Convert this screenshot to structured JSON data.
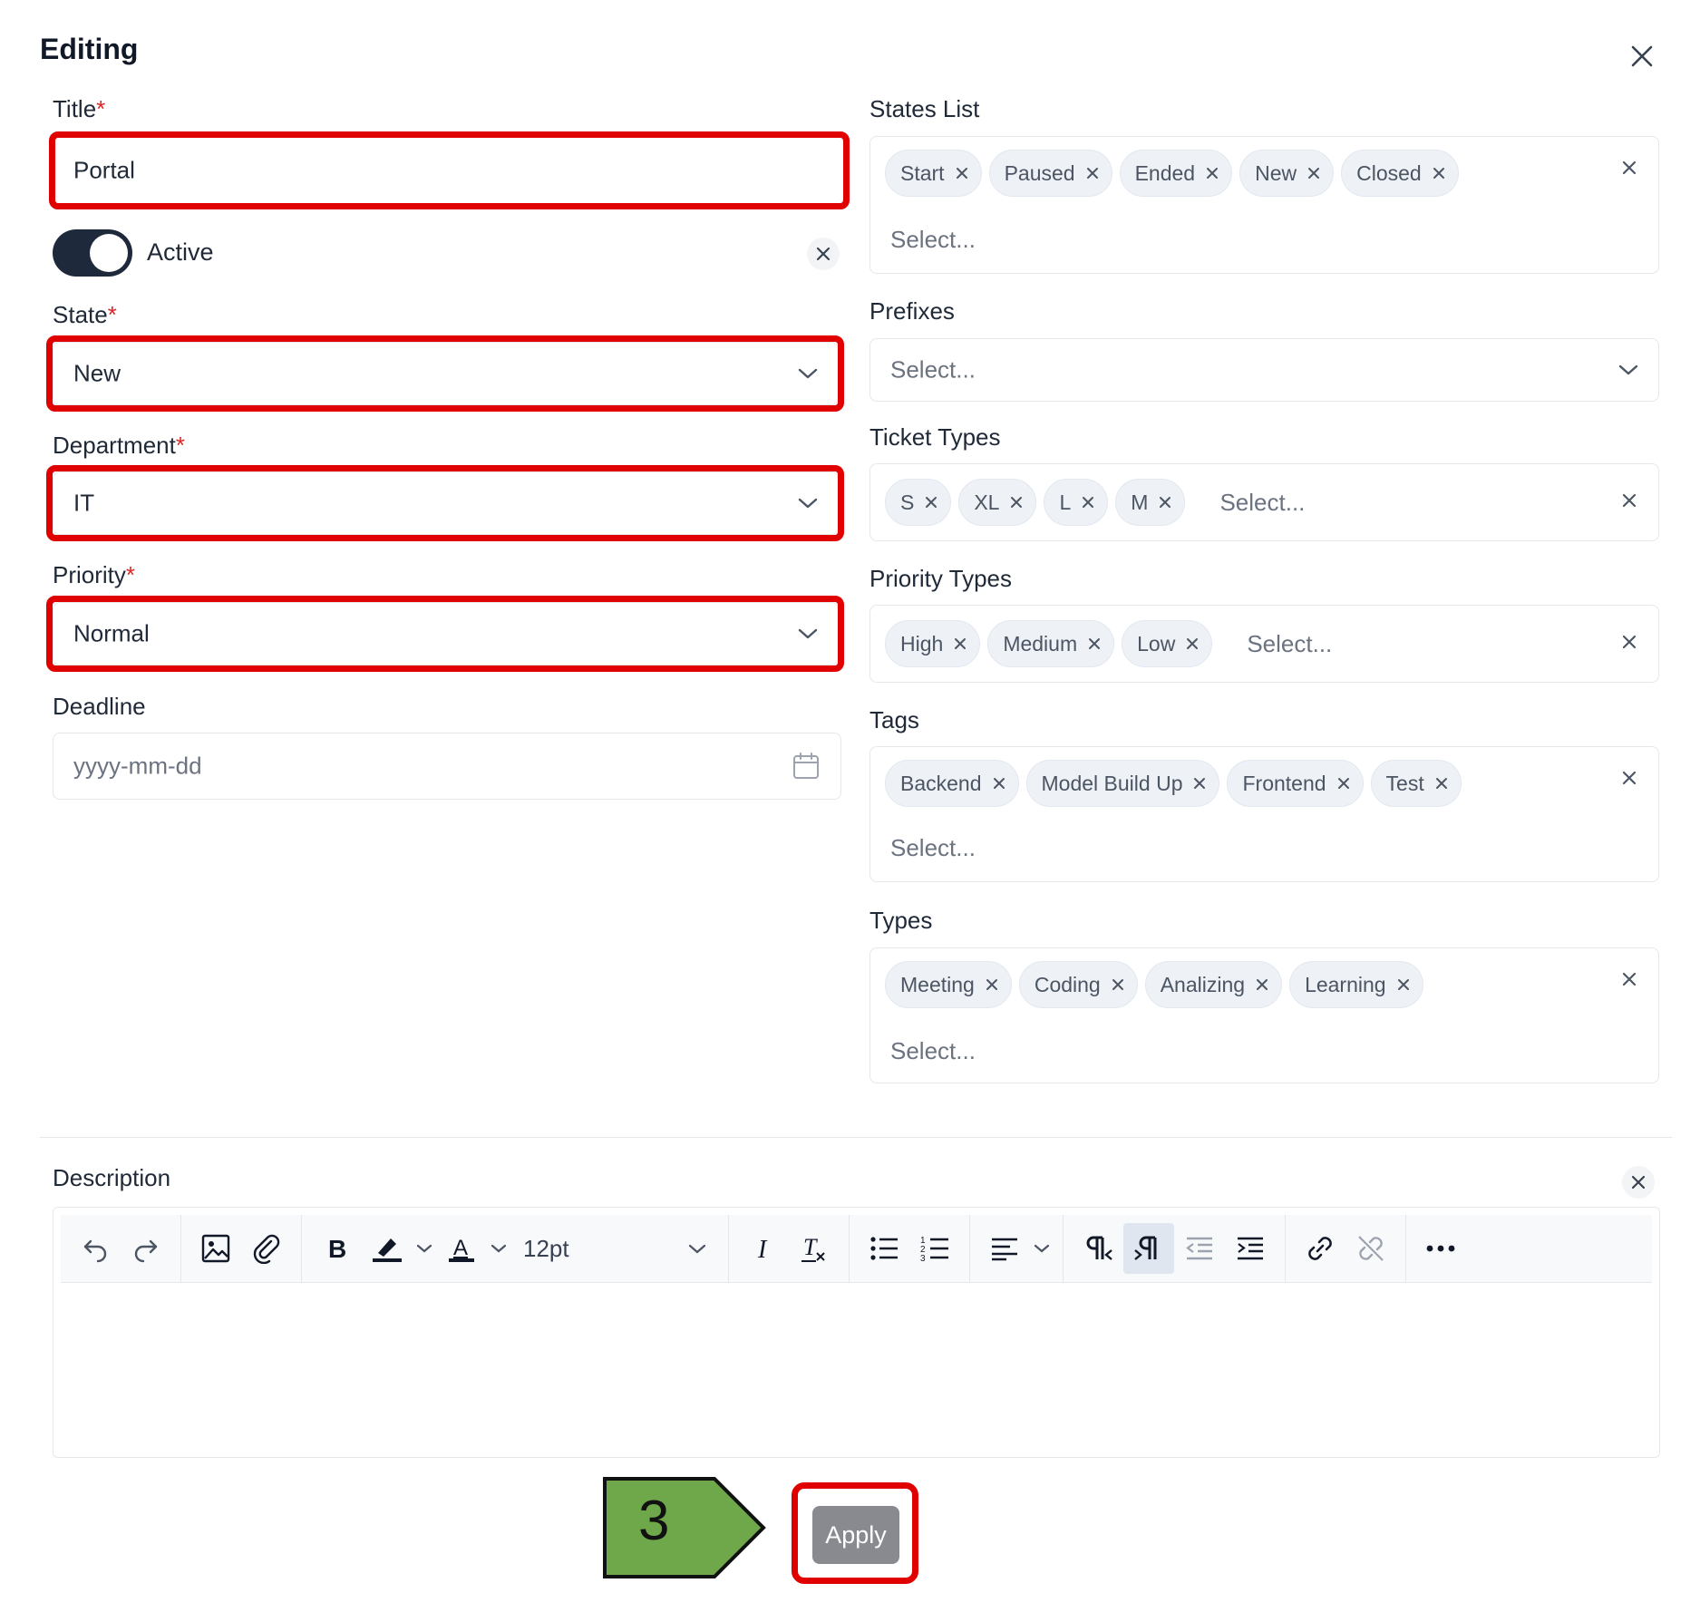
{
  "dialog": {
    "title": "Editing"
  },
  "required_mark": "*",
  "left": {
    "title": {
      "label": "Title",
      "value": "Portal"
    },
    "active": {
      "label": "Active",
      "on": true
    },
    "state": {
      "label": "State",
      "value": "New"
    },
    "department": {
      "label": "Department",
      "value": "IT"
    },
    "priority": {
      "label": "Priority",
      "value": "Normal"
    },
    "deadline": {
      "label": "Deadline",
      "placeholder": "yyyy-mm-dd"
    }
  },
  "right": {
    "states_list": {
      "label": "States List",
      "chips": [
        "Start",
        "Paused",
        "Ended",
        "New",
        "Closed"
      ],
      "placeholder": "Select..."
    },
    "prefixes": {
      "label": "Prefixes",
      "placeholder": "Select..."
    },
    "ticket_types": {
      "label": "Ticket Types",
      "chips": [
        "S",
        "XL",
        "L",
        "M"
      ],
      "placeholder": "Select..."
    },
    "priority_types": {
      "label": "Priority Types",
      "chips": [
        "High",
        "Medium",
        "Low"
      ],
      "placeholder": "Select..."
    },
    "tags": {
      "label": "Tags",
      "chips": [
        "Backend",
        "Model Build Up",
        "Frontend",
        "Test"
      ],
      "placeholder": "Select..."
    },
    "types": {
      "label": "Types",
      "chips": [
        "Meeting",
        "Coding",
        "Analizing",
        "Learning"
      ],
      "placeholder": "Select..."
    }
  },
  "description": {
    "label": "Description",
    "font_size": "12pt",
    "toolbar_icons": [
      "undo-icon",
      "redo-icon",
      "image-icon",
      "attachment-icon",
      "bold-icon",
      "highlight-icon",
      "font-color-icon",
      "italic-icon",
      "clear-format-icon",
      "bullet-list-icon",
      "numbered-list-icon",
      "align-left-icon",
      "ltr-icon",
      "rtl-icon",
      "outdent-icon",
      "indent-icon",
      "link-icon",
      "unlink-icon",
      "more-icon"
    ]
  },
  "footer": {
    "step_number": "3",
    "apply_label": "Apply"
  },
  "colors": {
    "highlight": "#e00000",
    "step_arrow": "#6fa84a",
    "toggle_on": "#1e293b",
    "apply_button": "#888a8f"
  }
}
